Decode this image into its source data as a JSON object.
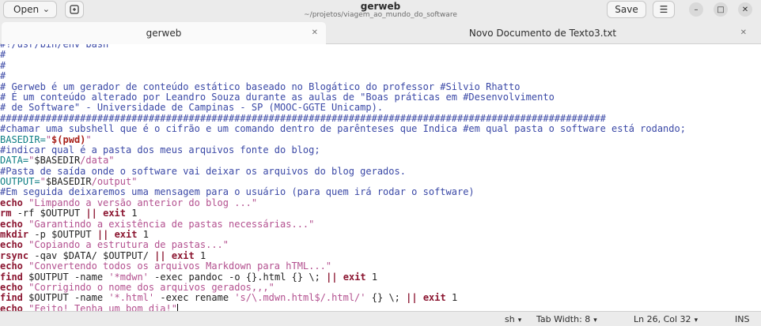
{
  "titlebar": {
    "open_label": "Open",
    "title": "gerweb",
    "subtitle": "~/projetos/viagem_ao_mundo_do_software",
    "save_label": "Save"
  },
  "tabs": [
    {
      "label": "gerweb",
      "active": true
    },
    {
      "label": "Novo Documento de Texto3.txt",
      "active": false
    }
  ],
  "editor": {
    "lines": [
      "#!/usr/bin/env bash",
      "#",
      "#",
      "#",
      "# Gerweb é um gerador de conteúdo estático baseado no Blogático do professor #Silvio Rhatto",
      "# É um conteúdo alterado por Leandro Souza durante as aulas de \"Boas práticas em #Desenvolvimento",
      "# de Software\" - Universidade de Campinas - SP (MOOC-GGTE Unicamp).",
      "##########################################################################################################",
      "#chamar uma subshell que é o cifrão e um comando dentro de parênteses que Indica #em qual pasta o software está rodando;",
      "BASEDIR=\"$(pwd)\"",
      "#indicar qual é a pasta dos meus arquivos fonte do blog;",
      "DATA=\"$BASEDIR/data\"",
      "#Pasta de saída onde o software vai deixar os arquivos do blog gerados.",
      "OUTPUT=\"$BASEDIR/output\"",
      "#Em seguida deixaremos uma mensagem para o usuário (para quem irá rodar o software)",
      "echo \"Limpando a versão anterior do blog ...\"",
      "rm -rf $OUTPUT || exit 1",
      "echo \"Garantindo a existência de pastas necessárias...\"",
      "mkdir -p $OUTPUT || exit 1",
      "echo \"Copiando a estrutura de pastas...\"",
      "rsync -qav $DATA/ $OUTPUT/ || exit 1",
      "echo \"Convertendo todos os arquivos Markdown para hTML...\"",
      "find $OUTPUT -name '*mdwn' -exec pandoc -o {}.html {} \\; || exit 1",
      "echo \"Corrigindo o nome dos arquivos gerados,,,\"",
      "find $OUTPUT -name '*.html' -exec rename 's/\\.mdwn.html$/.html/' {} \\; || exit 1",
      "echo \"Feito! Tenha um bom dia!\""
    ]
  },
  "statusbar": {
    "language": "sh",
    "tab_width": "Tab Width: 8",
    "position": "Ln 26, Col 32",
    "mode": "INS"
  }
}
